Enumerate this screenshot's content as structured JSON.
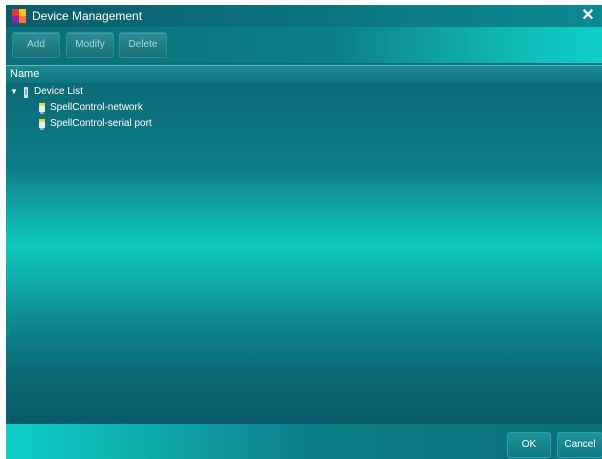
{
  "window": {
    "title": "Device Management",
    "close_glyph": "✕"
  },
  "toolbar": {
    "add_label": "Add",
    "modify_label": "Modify",
    "delete_label": "Delete"
  },
  "list": {
    "column_header": "Name",
    "root": {
      "label": "Device List",
      "expanded": true,
      "icon": "device-list-icon",
      "children": [
        {
          "label": "SpellControl-network",
          "icon": "device-icon"
        },
        {
          "label": "SpellControl-serial port",
          "icon": "device-icon"
        }
      ]
    }
  },
  "footer": {
    "ok_label": "OK",
    "cancel_label": "Cancel"
  },
  "colors": {
    "accent_cyan": "#0ed0c8",
    "dark_teal": "#0a5b6a",
    "text": "#ffffff"
  }
}
